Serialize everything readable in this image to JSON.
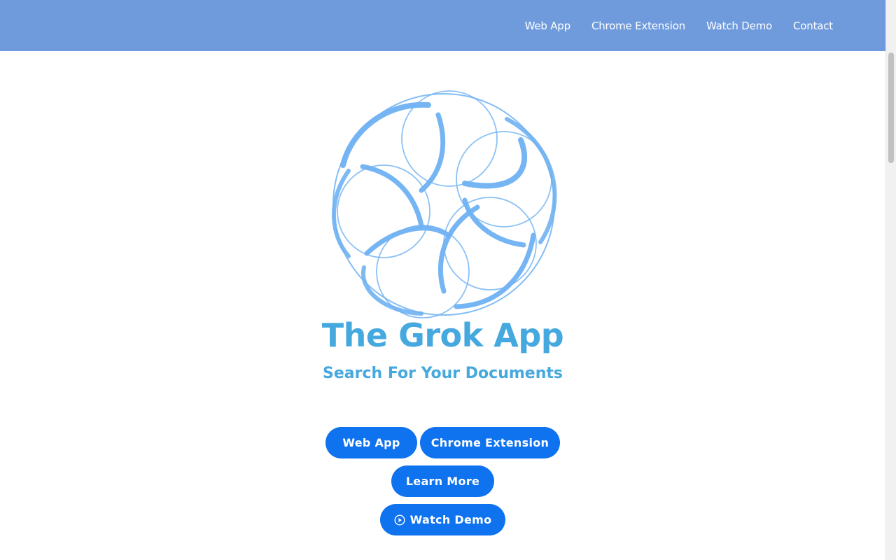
{
  "nav": {
    "items": [
      {
        "label": "Web App"
      },
      {
        "label": "Chrome Extension"
      },
      {
        "label": "Watch Demo"
      },
      {
        "label": "Contact"
      }
    ]
  },
  "hero": {
    "logo_icon": "swirl-flower-logo-icon",
    "title": "The Grok App",
    "subtitle": "Search For Your Documents"
  },
  "buttons": {
    "web_app": "Web App",
    "chrome_extension": "Chrome Extension",
    "learn_more": "Learn More",
    "watch_demo": "Watch Demo",
    "watch_demo_icon": "play-circle-icon"
  },
  "colors": {
    "header_bg": "#6f9bdc",
    "title": "#45a8de",
    "button_bg": "#0f72ef",
    "logo_stroke": "#6fb1f2"
  }
}
